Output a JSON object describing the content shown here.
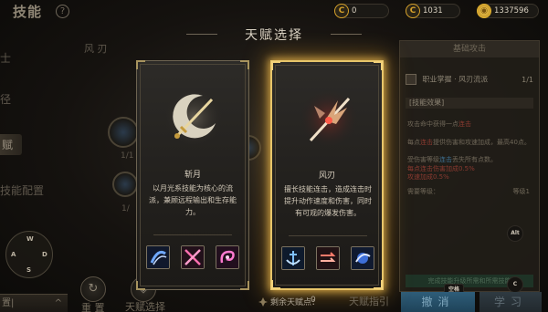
{
  "background": {
    "title": "技能",
    "help": "?",
    "left_tabs": [
      "士",
      "径",
      "赋",
      "技能配置"
    ],
    "wind_label": "风 刃",
    "node_counts": [
      "1/1",
      "1/"
    ],
    "joystick": {
      "up": "W",
      "left": "A",
      "right": "D",
      "down": "S"
    },
    "bottom_tab_label": "置|",
    "bottom_tab_caret": "^",
    "reset_label": "重 置",
    "talent_select_label": "天赋选择",
    "talent_guide_label": "天赋指引",
    "remaining_points_label": "剩余天赋点：",
    "remaining_points_value": "0"
  },
  "currency": [
    {
      "icon": "c-coin-icon",
      "value": "0",
      "color": "#d6a12a"
    },
    {
      "icon": "c-coin-icon",
      "value": "1031",
      "color": "#d6a12a"
    },
    {
      "icon": "gold-coin-icon",
      "value": "1337596",
      "color": "#e2b22e"
    }
  ],
  "right_panel": {
    "header": "基础攻击",
    "skill_name": "职业掌握 · 风刃流派",
    "skill_level": "1/1",
    "effect_label": "[技能效果]",
    "line1_a": "攻击命中获得一点",
    "line1_b": "连击",
    "line2_a": "每点",
    "line2_b": "连击",
    "line2_c": "提供伤害和攻速加成，最高40点。",
    "line3_a": "受伤害等级",
    "line3_b": "连击",
    "line3_c": "丢失所有点数。",
    "line4": "每点连击伤害加成0.5%",
    "line5": "攻速加成0.5%",
    "level_left": "需要等级：",
    "level_right": "等级1",
    "footer_bar": "完成技能升级所需和所需技能",
    "cancel_label": "撤消",
    "learn_label": "学习",
    "key_enter": "空格",
    "key_c": "C",
    "key_alt": "Alt"
  },
  "modal": {
    "title": "天赋选择",
    "cards": [
      {
        "name": "斩月",
        "description": "以月光系技能为核心的流派，兼顾远程输出和生存能力。",
        "skills": [
          "blue-slash-skill-icon",
          "crossed-blades-skill-icon",
          "pink-swirl-skill-icon"
        ],
        "selected": false
      },
      {
        "name": "风刃",
        "description": "擅长技能连击，造成连击时提升动作速度和伤害，同时有可观的爆发伤害。",
        "skills": [
          "blue-anchor-skill-icon",
          "red-arrows-skill-icon",
          "blue-orb-skill-icon"
        ],
        "selected": true
      }
    ]
  },
  "colors": {
    "accent_gold": "#e7c56a",
    "cancel_blue": "#2e5d79"
  }
}
